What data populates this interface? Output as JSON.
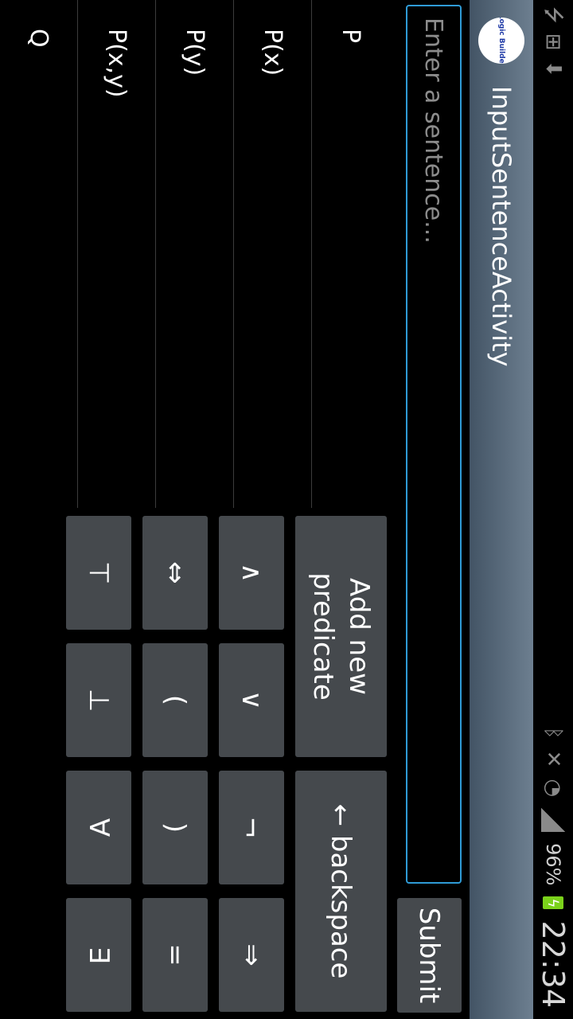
{
  "status_bar": {
    "left_icons": [
      "usb-icon",
      "grid-icon",
      "download-icon"
    ],
    "right_icons": [
      "bluetooth-icon",
      "mute-icon",
      "wifi-icon",
      "signal-icon"
    ],
    "battery_percent": "96%",
    "clock": "22:34"
  },
  "action_bar": {
    "logo_text": "Logic Builder",
    "title": "InputSentenceActivity"
  },
  "input": {
    "placeholder": "Enter a sentence...",
    "value": ""
  },
  "buttons": {
    "submit": "Submit",
    "add_predicate": "Add new predicate",
    "backspace": "← backspace"
  },
  "symbols": [
    [
      "∧",
      "∨",
      "¬",
      "⇒"
    ],
    [
      "⇔",
      "(",
      ")",
      "="
    ],
    [
      "⊤",
      "⊥",
      "∀",
      "∃"
    ]
  ],
  "predicates": [
    "P",
    "P(x)",
    "P(y)",
    "P(x,y)",
    "Q"
  ],
  "colors": {
    "accent": "#2f9bd6",
    "button_bg": "#45494d",
    "battery": "#7bd21b"
  }
}
